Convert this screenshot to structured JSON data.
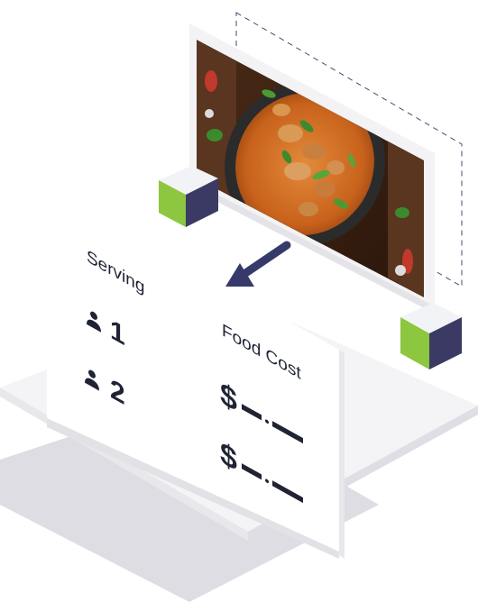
{
  "card": {
    "serving_heading": "Serving",
    "food_cost_heading": "Food Cost",
    "servings": [
      {
        "icon": "person-icon",
        "count": "1"
      },
      {
        "icon": "person-icon",
        "count": "2"
      }
    ],
    "costs": [
      {
        "currency": "$"
      },
      {
        "currency": "$"
      }
    ]
  },
  "colors": {
    "cube_green": "#8dc63f",
    "cube_navy": "#3b3a64",
    "cube_top": "#f2f3f6",
    "arrow": "#363a6b",
    "text": "#1f2333",
    "platform_shadow": "#dcdce3"
  },
  "photo": {
    "icon": "thai-curry-photo"
  }
}
